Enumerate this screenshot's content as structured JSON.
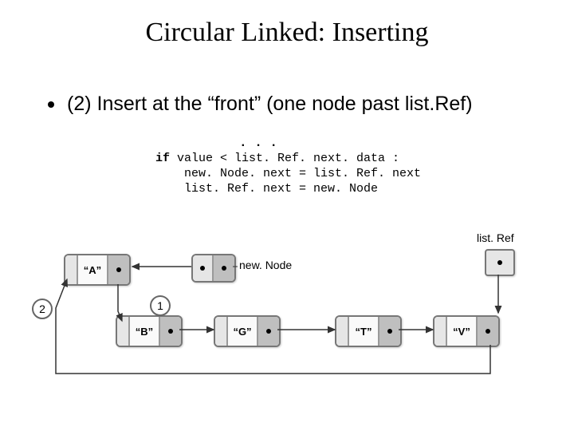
{
  "title": "Circular Linked: Inserting",
  "bullet": "(2) Insert at the “front” (one node past list.Ref)",
  "ellipsis": ". . .",
  "code": {
    "kw": "if",
    "line1_rest": " value < list. Ref. next. data :",
    "line2": "    new. Node. next = list. Ref. next",
    "line3": "    list. Ref. next = new. Node"
  },
  "labels": {
    "newNode": "new. Node",
    "listRef": "list. Ref",
    "circ1": "1",
    "circ2": "2"
  },
  "nodes": {
    "a": "“A”",
    "b": "“B”",
    "g": "“G”",
    "t": "“T”",
    "v": "“V”"
  }
}
